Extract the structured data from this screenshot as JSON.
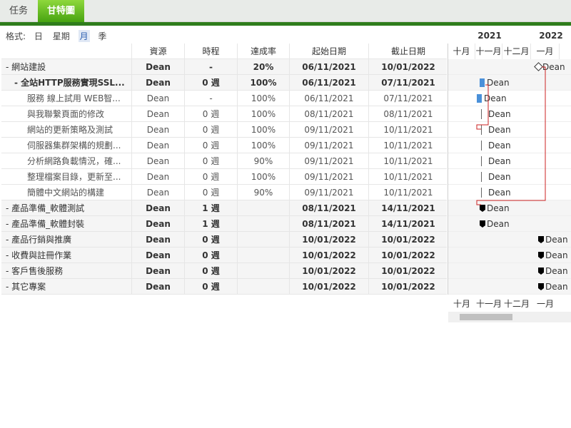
{
  "tabs": [
    {
      "label": "任务",
      "active": false
    },
    {
      "label": "甘特圖",
      "active": true
    }
  ],
  "format": {
    "label": "格式:",
    "options": [
      "日",
      "星期",
      "月",
      "季"
    ],
    "selected": "月"
  },
  "columns": [
    "資源",
    "時程",
    "達成率",
    "起始日期",
    "截止日期"
  ],
  "rows": [
    {
      "name": "- 網站建設",
      "resource": "Dean",
      "duration": "-",
      "percent": "20%",
      "start": "06/11/2021",
      "end": "10/01/2022",
      "level": "group"
    },
    {
      "name": "- 全站HTTP服務實現SSL...",
      "resource": "Dean",
      "duration": "0 週",
      "percent": "100%",
      "start": "06/11/2021",
      "end": "07/11/2021",
      "level": "sub"
    },
    {
      "name": "服務 線上試用 WEB智...",
      "resource": "Dean",
      "duration": "-",
      "percent": "100%",
      "start": "06/11/2021",
      "end": "07/11/2021",
      "level": "child"
    },
    {
      "name": "與我聯繫頁面的修改",
      "resource": "Dean",
      "duration": "0 週",
      "percent": "100%",
      "start": "08/11/2021",
      "end": "08/11/2021",
      "level": "child"
    },
    {
      "name": "網站的更新策略及測試",
      "resource": "Dean",
      "duration": "0 週",
      "percent": "100%",
      "start": "09/11/2021",
      "end": "10/11/2021",
      "level": "child"
    },
    {
      "name": "伺服器集群架構的規劃...",
      "resource": "Dean",
      "duration": "0 週",
      "percent": "100%",
      "start": "09/11/2021",
      "end": "10/11/2021",
      "level": "child"
    },
    {
      "name": "分析網路負載情況，確...",
      "resource": "Dean",
      "duration": "0 週",
      "percent": "90%",
      "start": "09/11/2021",
      "end": "10/11/2021",
      "level": "child"
    },
    {
      "name": "整理檔案目錄，更新至...",
      "resource": "Dean",
      "duration": "0 週",
      "percent": "100%",
      "start": "09/11/2021",
      "end": "10/11/2021",
      "level": "child"
    },
    {
      "name": "簡體中文網站的構建",
      "resource": "Dean",
      "duration": "0 週",
      "percent": "90%",
      "start": "09/11/2021",
      "end": "10/11/2021",
      "level": "child"
    },
    {
      "name": "- 產品準備_軟體測試",
      "resource": "Dean",
      "duration": "1 週",
      "percent": "",
      "start": "08/11/2021",
      "end": "14/11/2021",
      "level": "group"
    },
    {
      "name": "- 產品準備_軟體封裝",
      "resource": "Dean",
      "duration": "1 週",
      "percent": "",
      "start": "08/11/2021",
      "end": "14/11/2021",
      "level": "group"
    },
    {
      "name": "- 產品行銷與推廣",
      "resource": "Dean",
      "duration": "0 週",
      "percent": "",
      "start": "10/01/2022",
      "end": "10/01/2022",
      "level": "group"
    },
    {
      "name": "- 收費與註冊作業",
      "resource": "Dean",
      "duration": "0 週",
      "percent": "",
      "start": "10/01/2022",
      "end": "10/01/2022",
      "level": "group"
    },
    {
      "name": "- 客戶售後服務",
      "resource": "Dean",
      "duration": "0 週",
      "percent": "",
      "start": "10/01/2022",
      "end": "10/01/2022",
      "level": "group"
    },
    {
      "name": "- 其它專案",
      "resource": "Dean",
      "duration": "0 週",
      "percent": "",
      "start": "10/01/2022",
      "end": "10/01/2022",
      "level": "group"
    }
  ],
  "timeline": {
    "years": [
      "2021",
      "2022"
    ],
    "months": [
      "十月",
      "十一月",
      "十二月",
      "一月"
    ]
  },
  "colors": {
    "tab_active": "#47a311",
    "band": "#2f7d1c",
    "dependency": "#cc2222",
    "bar": "#4a90d9"
  },
  "chart_label": "Dean"
}
